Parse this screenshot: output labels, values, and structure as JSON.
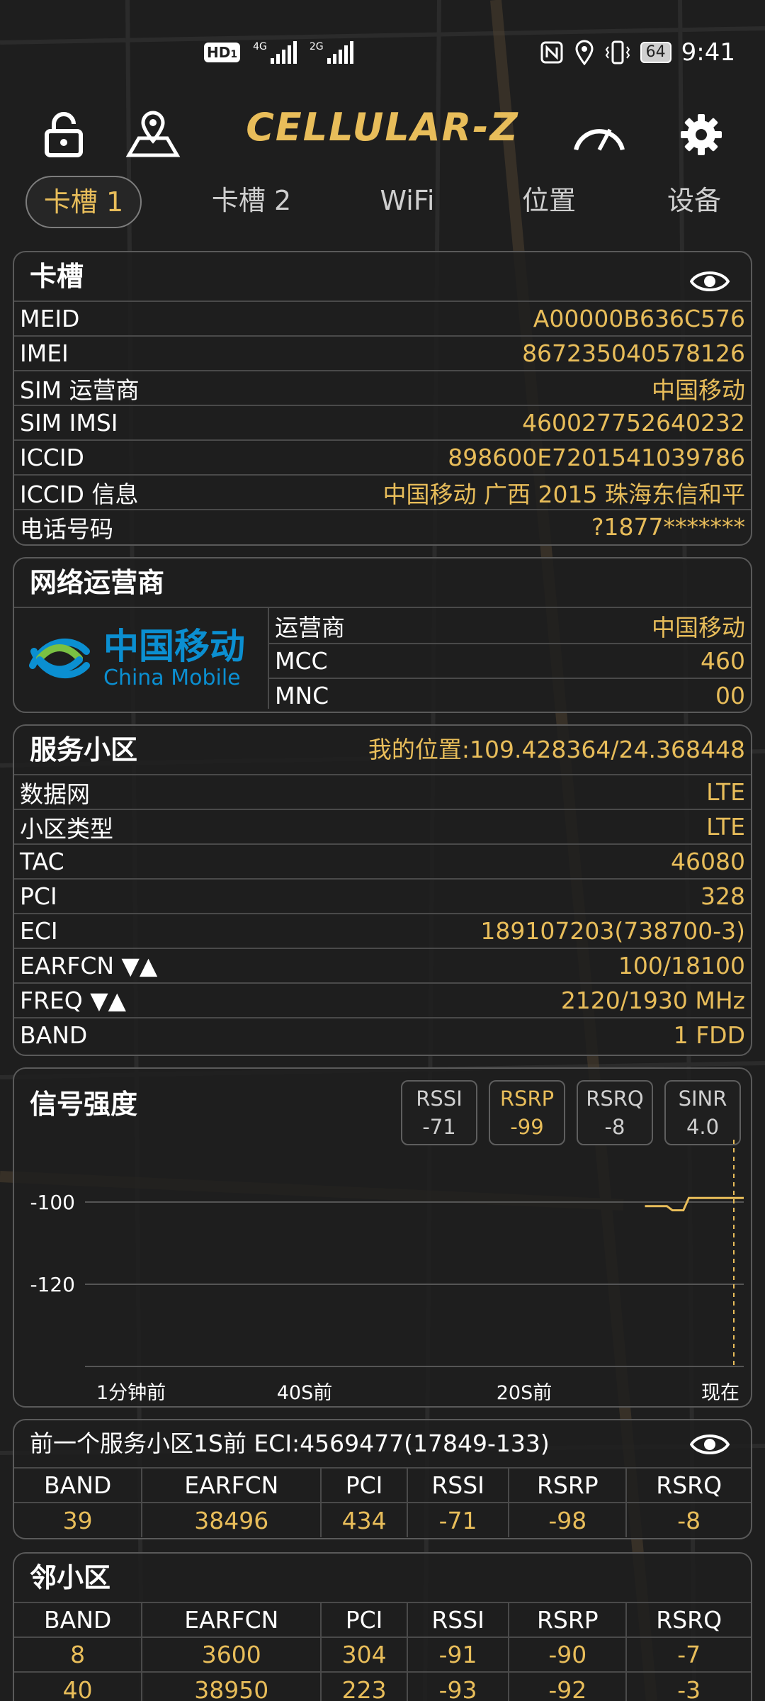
{
  "status_bar": {
    "time": "9:41",
    "battery": "64",
    "hd_label": "HD",
    "hd_sub": "1",
    "net1": "4G",
    "net2": "2G"
  },
  "app": {
    "title": "CELLULAR-Z"
  },
  "tabs": [
    {
      "label": "卡槽 1",
      "active": true
    },
    {
      "label": "卡槽 2",
      "active": false
    },
    {
      "label": "WiFi",
      "active": false
    },
    {
      "label": "位置",
      "active": false
    },
    {
      "label": "设备",
      "active": false
    }
  ],
  "sim_card": {
    "title": "卡槽",
    "rows": [
      {
        "key": "MEID",
        "value": "A00000B636C576"
      },
      {
        "key": "IMEI",
        "value": "867235040578126"
      },
      {
        "key": "SIM 运营商",
        "value": "中国移动"
      },
      {
        "key": "SIM IMSI",
        "value": "460027752640232"
      },
      {
        "key": "ICCID",
        "value": "898600E7201541039786"
      },
      {
        "key": "ICCID 信息",
        "value": "中国移动 广西 2015 珠海东信和平"
      },
      {
        "key": "电话号码",
        "value": "?1877*******"
      }
    ]
  },
  "operator_card": {
    "title": "网络运营商",
    "logo_cn": "中国移动",
    "logo_en": "China Mobile",
    "rows": [
      {
        "key": "运营商",
        "value": "中国移动"
      },
      {
        "key": "MCC",
        "value": "460"
      },
      {
        "key": "MNC",
        "value": "00"
      }
    ]
  },
  "serving_cell": {
    "title": "服务小区",
    "location": "我的位置:109.428364/24.368448",
    "rows": [
      {
        "key": "数据网",
        "value": "LTE"
      },
      {
        "key": "小区类型",
        "value": "LTE"
      },
      {
        "key": "TAC",
        "value": "46080"
      },
      {
        "key": "PCI",
        "value": "328"
      },
      {
        "key": "ECI",
        "value": "189107203(738700-3)"
      },
      {
        "key": "EARFCN ▼▲",
        "value": "100/18100"
      },
      {
        "key": "FREQ ▼▲",
        "value": "2120/1930 MHz"
      },
      {
        "key": "BAND",
        "value": "1 FDD"
      }
    ]
  },
  "signal": {
    "title": "信号强度",
    "chips": [
      {
        "label": "RSSI",
        "value": "-71",
        "active": false
      },
      {
        "label": "RSRP",
        "value": "-99",
        "active": true
      },
      {
        "label": "RSRQ",
        "value": "-8",
        "active": false
      },
      {
        "label": "SINR",
        "value": "4.0",
        "active": false
      }
    ]
  },
  "chart_data": {
    "type": "line",
    "title": "",
    "xlabel": "",
    "ylabel": "",
    "yticks": [
      "-100",
      "-120"
    ],
    "xticks": [
      "1分钟前",
      "40S前",
      "20S前",
      "现在"
    ],
    "ylim": [
      -140,
      -90
    ],
    "xlim": [
      -60,
      0
    ],
    "series": [
      {
        "color": "#e8bd5a",
        "x": [
          -9,
          -7,
          -6.5,
          -5.5,
          -5,
          -4,
          0
        ],
        "y": [
          -101,
          -101,
          -102,
          -102,
          -99,
          -99,
          -99
        ]
      }
    ]
  },
  "prev_cell": {
    "title": "前一个服务小区1S前 ECI:4569477(17849-133)",
    "headers": [
      "BAND",
      "EARFCN",
      "PCI",
      "RSSI",
      "RSRP",
      "RSRQ"
    ],
    "rows": [
      [
        "39",
        "38496",
        "434",
        "-71",
        "-98",
        "-8"
      ]
    ]
  },
  "neighbor": {
    "title": "邻小区",
    "headers": [
      "BAND",
      "EARFCN",
      "PCI",
      "RSSI",
      "RSRP",
      "RSRQ"
    ],
    "rows": [
      [
        "8",
        "3600",
        "304",
        "-91",
        "-90",
        "-7"
      ],
      [
        "40",
        "38950",
        "223",
        "-93",
        "-92",
        "-3"
      ]
    ]
  }
}
